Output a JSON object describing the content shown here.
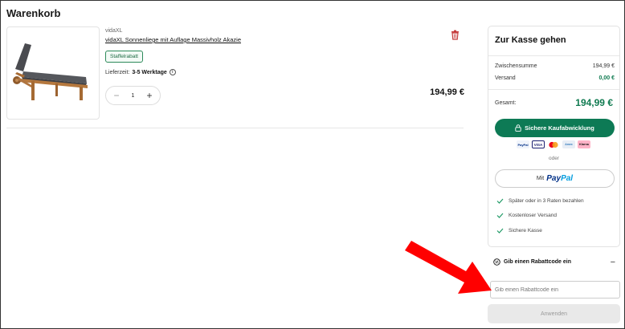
{
  "page": {
    "title": "Warenkorb"
  },
  "product": {
    "brand": "vidaXL",
    "title": "vidaXL Sonnenliege mit Auflage Massivholz Akazie",
    "badge": "Staffelrabatt",
    "delivery_label": "Lieferzeit:",
    "delivery_value": "3-5 Werktage",
    "quantity": "1",
    "price": "194,99 €",
    "image_icon": "sun-lounger-image"
  },
  "summary": {
    "title": "Zur Kasse gehen",
    "subtotal_label": "Zwischensumme",
    "subtotal_value": "194,99 €",
    "shipping_label": "Versand",
    "shipping_value": "0,00 €",
    "total_label": "Gesamt:",
    "total_value": "194,99 €",
    "checkout_label": "Sichere Kaufabwicklung",
    "payment_methods": [
      "PayPal",
      "VISA",
      "Mastercard",
      "Amex",
      "Klarna"
    ],
    "or_label": "oder",
    "paypal_prefix": "Mit",
    "paypal_brand_1": "Pay",
    "paypal_brand_2": "Pal",
    "benefits": [
      "Später oder in 3 Raten bezahlen",
      "Kostenloser Versand",
      "Sichere Kasse"
    ]
  },
  "discount": {
    "title": "Gib einen Rabattcode ein",
    "placeholder": "Gib einen Rabattcode ein",
    "apply_label": "Anwenden"
  },
  "colors": {
    "accent": "#0d7a55",
    "annotation_arrow": "#ff0000"
  }
}
